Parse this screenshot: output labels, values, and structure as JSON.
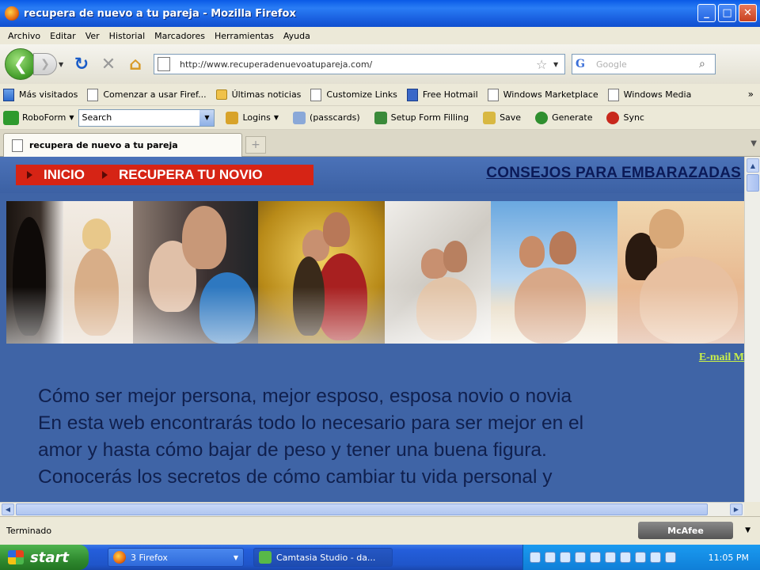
{
  "window": {
    "title": "recupera de nuevo a tu pareja - Mozilla Firefox",
    "buttons": {
      "minimize": "_",
      "maximize": "□",
      "close": "✕"
    }
  },
  "menu": [
    "Archivo",
    "Editar",
    "Ver",
    "Historial",
    "Marcadores",
    "Herramientas",
    "Ayuda"
  ],
  "nav": {
    "url": "http://www.recuperadenuevoatupareja.com/",
    "search_placeholder": "Google"
  },
  "bookmarks": [
    {
      "label": "Más visitados",
      "icon": "bookmarks-icon"
    },
    {
      "label": "Comenzar a usar Firef...",
      "icon": "page-icon"
    },
    {
      "label": "Últimas noticias",
      "icon": "rss-folder-icon"
    },
    {
      "label": "Customize Links",
      "icon": "page-icon"
    },
    {
      "label": "Free Hotmail",
      "icon": "hotmail-icon"
    },
    {
      "label": "Windows Marketplace",
      "icon": "page-icon"
    },
    {
      "label": "Windows Media",
      "icon": "page-icon"
    }
  ],
  "roboform": {
    "label": "RoboForm",
    "search_value": "Search",
    "buttons": [
      {
        "label": "Logins",
        "color": "#d8a32a"
      },
      {
        "label": "(passcards)",
        "color": "#8aa8d8"
      },
      {
        "label": "Setup Form Filling",
        "color": "#3a8a3a"
      },
      {
        "label": "Save",
        "color": "#d8b842"
      },
      {
        "label": "Generate",
        "color": "#2f8f2f"
      },
      {
        "label": "Sync",
        "color": "#c8281c"
      }
    ]
  },
  "tab": {
    "label": "recupera de nuevo a tu pareja"
  },
  "page": {
    "menu_items": [
      "INICIO",
      "RECUPERA TU NOVIO"
    ],
    "right_link": "CONSEJOS PARA EMBARAZADAS",
    "email_link": "E-mail M",
    "body_lines": [
      "Cómo ser mejor persona,  mejor esposo, esposa novio o novia",
      "En esta web encontrarás todo lo necesario para ser mejor en el",
      "amor y hasta cómo bajar de peso y tener una buena figura.",
      "Conocerás los secretos de cómo cambiar tu vida personal  y"
    ]
  },
  "status": {
    "text": "Terminado",
    "mcafee": "McAfee"
  },
  "taskbar": {
    "start": "start",
    "tasks": [
      "3 Firefox",
      "Camtasia Studio - da..."
    ],
    "clock": "11:05 PM"
  }
}
